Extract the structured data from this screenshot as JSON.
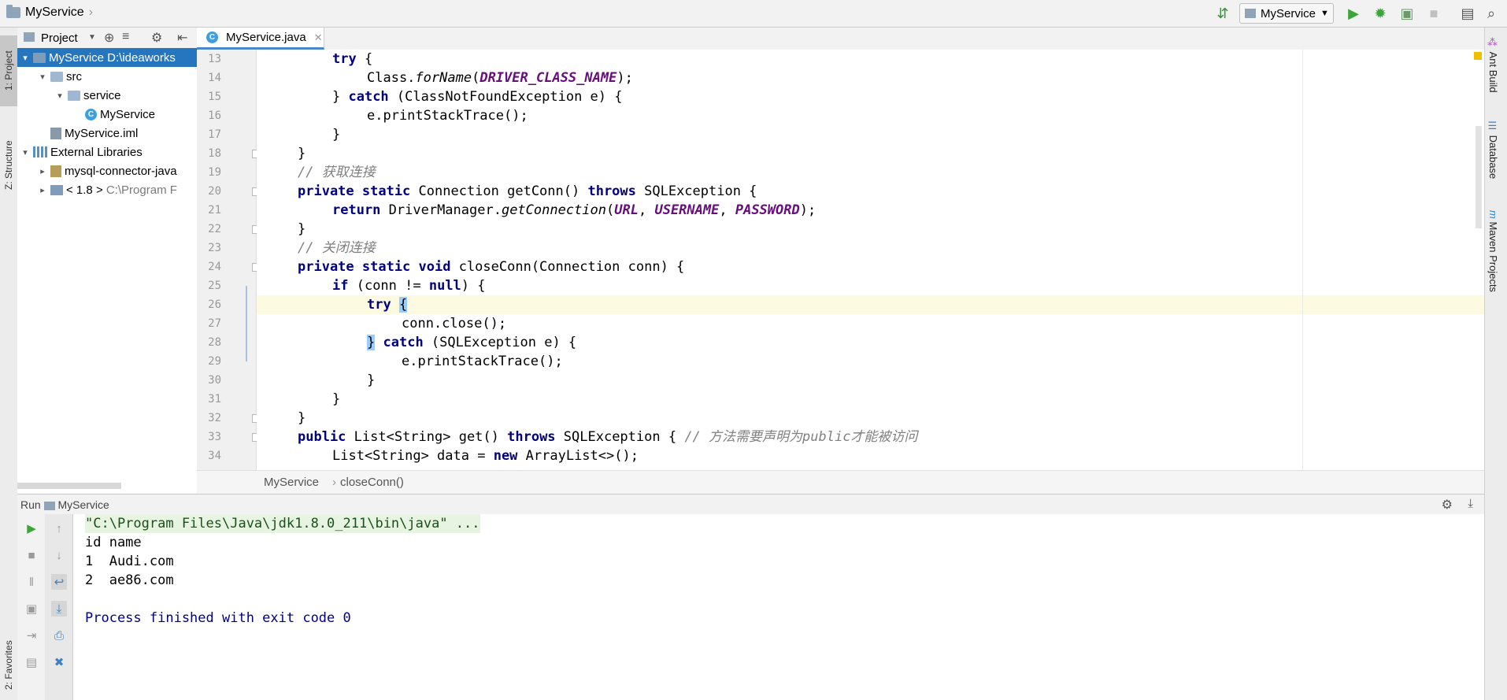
{
  "navbar": {
    "project": "MyService",
    "run_config": "MyService"
  },
  "left_strip": {
    "project_tab": "1: Project",
    "structure_tab": "Z: Structure",
    "favorites_tab": "2: Favorites"
  },
  "project_panel": {
    "header": "Project",
    "tree": [
      {
        "label": "MyService",
        "hint": "D:\\ideaworks",
        "depth": 0,
        "expanded": true,
        "selected": true,
        "icon": "module-icon"
      },
      {
        "label": "src",
        "hint": "",
        "depth": 1,
        "expanded": true,
        "icon": "folder-icon"
      },
      {
        "label": "service",
        "hint": "",
        "depth": 2,
        "expanded": true,
        "icon": "package-icon"
      },
      {
        "label": "MyService",
        "hint": "",
        "depth": 3,
        "icon": "class-icon"
      },
      {
        "label": "MyService.iml",
        "hint": "",
        "depth": 1,
        "icon": "iml-file-icon"
      },
      {
        "label": "External Libraries",
        "hint": "",
        "depth": 0,
        "expanded": true,
        "icon": "libraries-icon"
      },
      {
        "label": "mysql-connector-java",
        "hint": "",
        "depth": 1,
        "expanded": false,
        "icon": "jar-icon"
      },
      {
        "label": "< 1.8 >",
        "hint": "C:\\Program F",
        "depth": 1,
        "expanded": false,
        "icon": "jdk-icon"
      }
    ]
  },
  "editor": {
    "tab_label": "MyService.java",
    "breadcrumb": [
      "MyService",
      "closeConn()"
    ],
    "line_numbers": [
      "13",
      "14",
      "15",
      "16",
      "17",
      "18",
      "19",
      "20",
      "21",
      "22",
      "23",
      "24",
      "25",
      "26",
      "27",
      "28",
      "29",
      "30",
      "31",
      "32",
      "33",
      "34"
    ]
  },
  "right_strip": {
    "ant": "Ant Build",
    "database": "Database",
    "maven": "Maven Projects"
  },
  "run": {
    "header": "Run",
    "config": "MyService",
    "console": {
      "cmd": "\"C:\\Program Files\\Java\\jdk1.8.0_211\\bin\\java\" ...",
      "header": "id name",
      "row1": "1  Audi.com",
      "row2": "2  ae86.com",
      "exit": "Process finished with exit code 0"
    }
  },
  "code": {
    "l13a": "try",
    "l13b": " {",
    "l14a": "Class.",
    "l14b": "forName",
    "l14c": "(",
    "l14d": "DRIVER_CLASS_NAME",
    "l14e": ");",
    "l15a": "} ",
    "l15b": "catch",
    "l15c": " (ClassNotFoundException e) {",
    "l16": "e.printStackTrace();",
    "l17": "}",
    "l18": "}",
    "l19": "// 获取连接",
    "l20a": "private static",
    "l20b": " Connection getConn() ",
    "l20c": "throws",
    "l20d": " SQLException {",
    "l21a": "return",
    "l21b": " DriverManager.",
    "l21c": "getConnection",
    "l21d": "(",
    "l21e": "URL",
    "l21f": ", ",
    "l21g": "USERNAME",
    "l21h": ", ",
    "l21i": "PASSWORD",
    "l21j": ");",
    "l22": "}",
    "l23": "// 关闭连接",
    "l24a": "private static void",
    "l24b": " closeConn(Connection conn) {",
    "l25a": "if",
    "l25b": " (conn != ",
    "l25c": "null",
    "l25d": ") {",
    "l26a": "try",
    "l26b": "{",
    "l27": "conn.close();",
    "l28a": "}",
    "l28b": "catch",
    "l28c": " (SQLException e) {",
    "l29": "e.printStackTrace();",
    "l30": "}",
    "l31": "}",
    "l32": "}",
    "l33a": "public",
    "l33b": " List<String> get() ",
    "l33c": "throws",
    "l33d": " SQLException { ",
    "l33e": "// 方法需要声明为public才能被访问",
    "l34a": "List<String> data = ",
    "l34b": "new",
    "l34c": " ArrayList<>();"
  }
}
